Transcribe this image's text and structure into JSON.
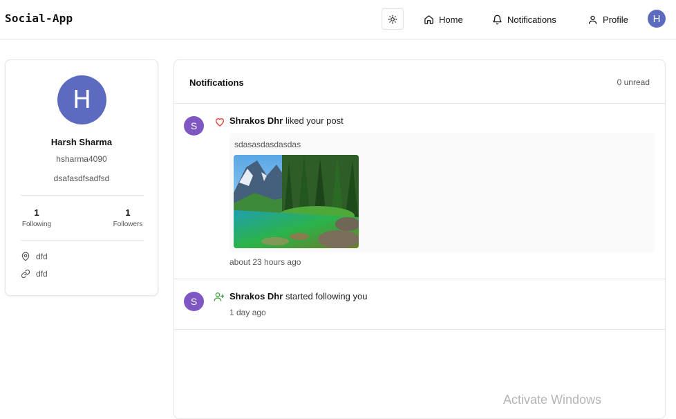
{
  "nav": {
    "brand": "Social-App",
    "home": "Home",
    "notifications": "Notifications",
    "profile": "Profile",
    "avatar_initial": "H"
  },
  "profile": {
    "avatar_initial": "H",
    "name": "Harsh Sharma",
    "username": "hsharma4090",
    "bio": "dsafasdfsadfsd",
    "following_count": "1",
    "following_label": "Following",
    "followers_count": "1",
    "followers_label": "Followers",
    "location": "dfd",
    "website": "dfd"
  },
  "notifications": {
    "title": "Notifications",
    "unread": "0 unread",
    "items": [
      {
        "avatar_initial": "S",
        "icon": "heart-icon",
        "user": "Shrakos Dhr",
        "action": "liked your post",
        "post_text": "sdasasdasdasdas",
        "image": "mountain-lake-photo",
        "time": "about 23 hours ago"
      },
      {
        "avatar_initial": "S",
        "icon": "user-plus-icon",
        "user": "Shrakos Dhr",
        "action": "started following you",
        "time": "1 day ago"
      }
    ]
  },
  "os_watermark": "Activate Windows",
  "colors": {
    "avatar_user": "#5c6bc0",
    "avatar_other": "#7e57c2",
    "like": "#e53935",
    "follow": "#43a047"
  }
}
